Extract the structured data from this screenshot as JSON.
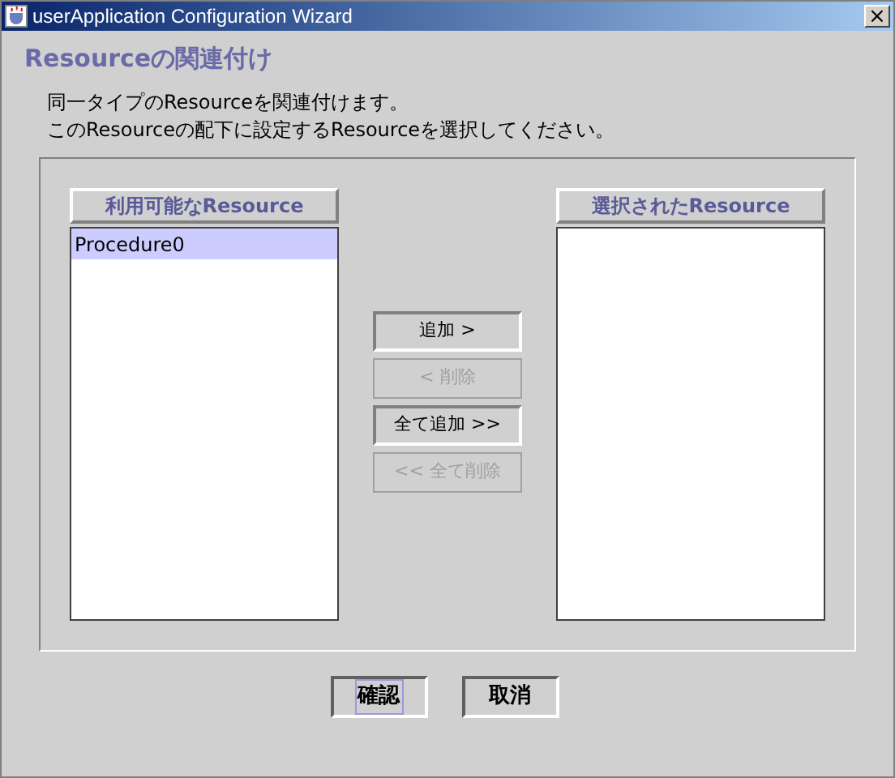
{
  "window": {
    "title": "userApplication Configuration Wizard",
    "close": "×"
  },
  "heading": "Resourceの関連付け",
  "description": [
    "同一タイプのResourceを関連付けます。",
    "このResourceの配下に設定するResourceを選択してください。"
  ],
  "available_list": {
    "header": "利用可能なResource",
    "items": [
      {
        "label": "Procedure0",
        "selected": true
      }
    ]
  },
  "move_buttons": [
    {
      "label": "追加 >",
      "disabled": false
    },
    {
      "label": "< 削除",
      "disabled": true
    },
    {
      "label": "全て追加 >>",
      "disabled": false
    },
    {
      "label": "<< 全て削除",
      "disabled": true
    }
  ],
  "selected_list": {
    "header": "選択されたResource"
  },
  "footer_buttons": [
    {
      "label": "確認",
      "focused": true
    },
    {
      "label": "取消",
      "focused": false
    }
  ]
}
